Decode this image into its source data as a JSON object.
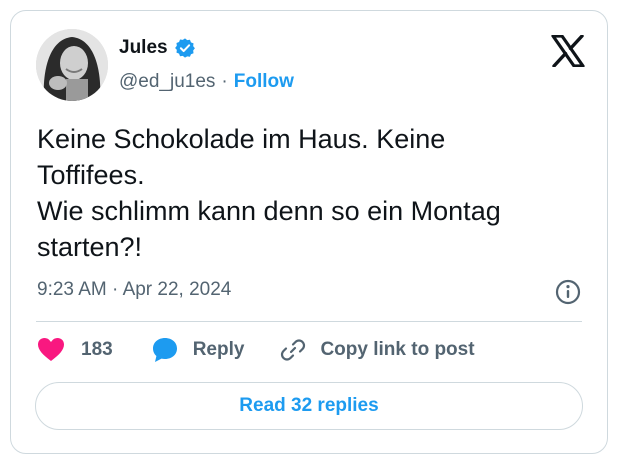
{
  "author": {
    "name": "Jules",
    "handle": "@ed_ju1es",
    "separator": "·",
    "follow_label": "Follow"
  },
  "tweet": {
    "text": "Keine Schokolade im Haus. Keine\nToffifees.\nWie schlimm kann denn so ein Montag\nstarten?!",
    "time": "9:23 AM",
    "meta_separator": "·",
    "date": "Apr 22, 2024"
  },
  "actions": {
    "like_count": "183",
    "reply_label": "Reply",
    "copy_label": "Copy link to post"
  },
  "footer": {
    "read_replies_label": "Read 32 replies"
  },
  "colors": {
    "accent": "#1d9bf0",
    "like": "#f91880",
    "text": "#0f1419",
    "muted": "#536471",
    "border": "#cfd9de"
  },
  "icons": {
    "verified": "verified-badge-icon",
    "brand": "x-logo-icon",
    "info": "info-icon",
    "like": "heart-icon",
    "reply": "speech-bubble-icon",
    "copy": "link-icon"
  }
}
